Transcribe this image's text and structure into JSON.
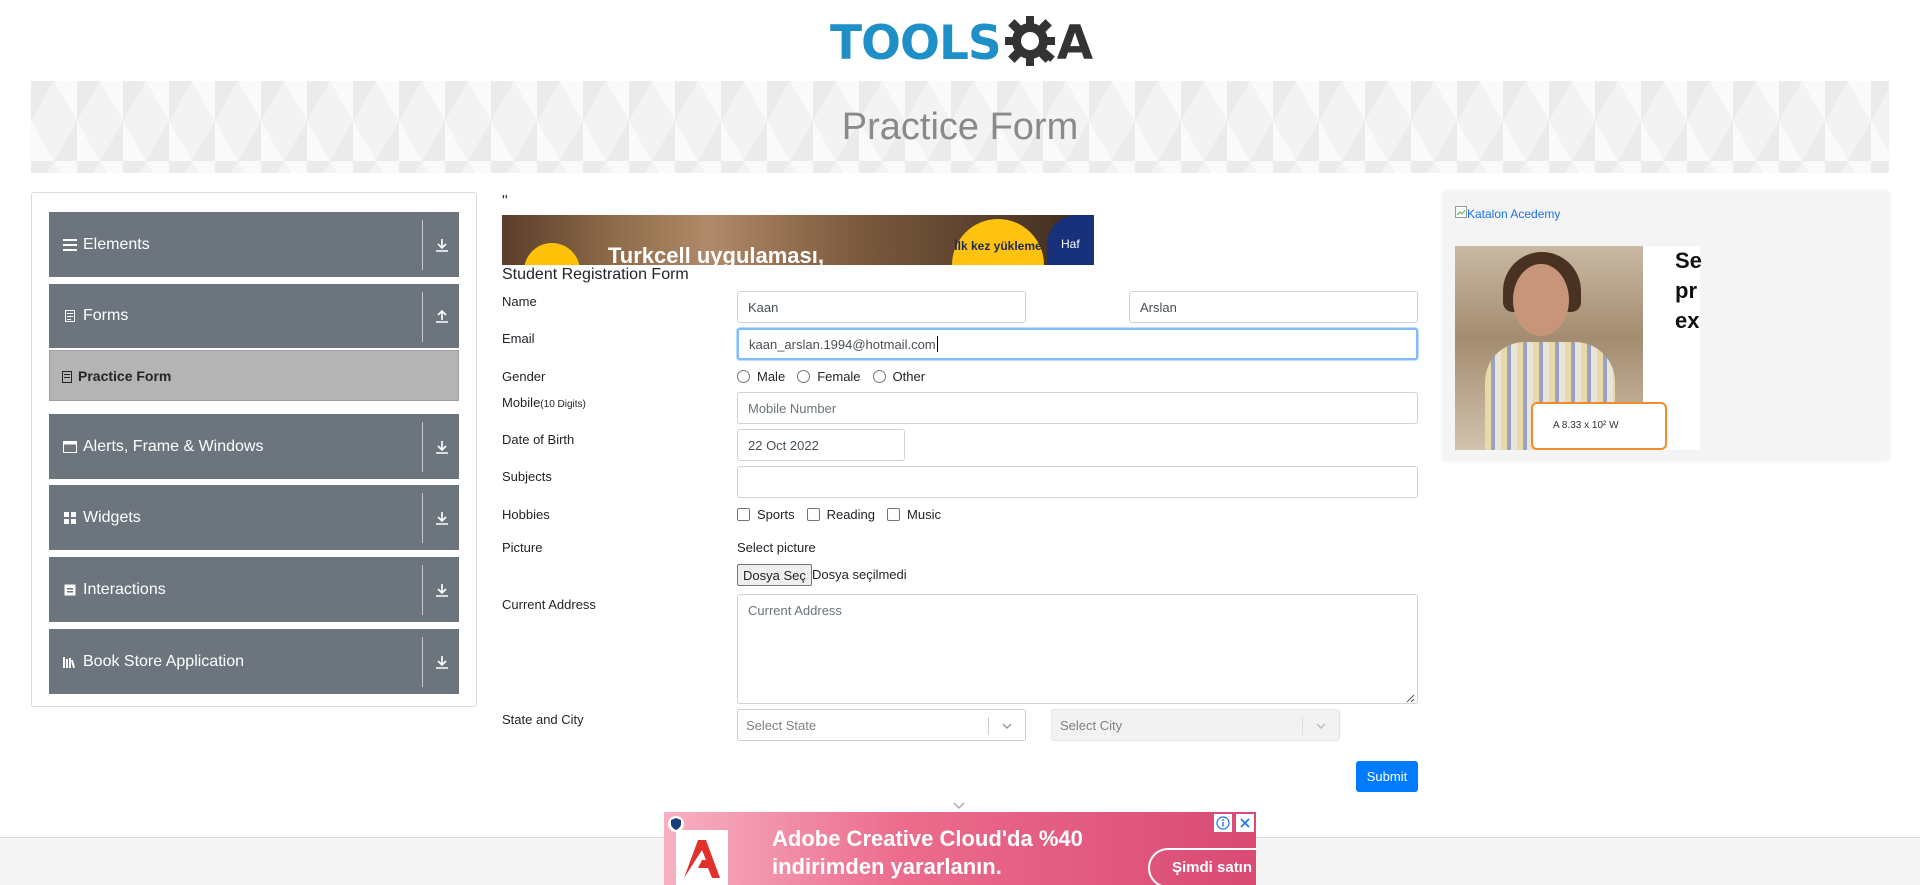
{
  "logo": {
    "text_left": "TOOLS",
    "text_right": "A"
  },
  "banner": {
    "title": "Practice Form"
  },
  "sidebar": {
    "groups": [
      {
        "label": "Elements",
        "icon": "hamburger-icon",
        "arrow": "download-icon"
      },
      {
        "label": "Forms",
        "icon": "form-doc-icon",
        "arrow": "upload-icon"
      },
      {
        "label": "Alerts, Frame & Windows",
        "icon": "window-icon",
        "arrow": "download-icon"
      },
      {
        "label": "Widgets",
        "icon": "grid-icon",
        "arrow": "download-icon"
      },
      {
        "label": "Interactions",
        "icon": "interaction-icon",
        "arrow": "download-icon"
      },
      {
        "label": "Book Store Application",
        "icon": "bookshelf-icon",
        "arrow": "download-icon"
      }
    ],
    "sub_item": {
      "label": "Practice Form",
      "icon": "form-small-icon"
    }
  },
  "main": {
    "quote": "\"",
    "top_ad": {
      "text": "Turkcell uygulaması,",
      "badge": "İlk kez yükleme",
      "side": "Haf"
    },
    "form_title": "Student Registration Form",
    "labels": {
      "name": "Name",
      "email": "Email",
      "gender": "Gender",
      "mobile": "Mobile",
      "mobile_hint": "(10 Digits)",
      "dob": "Date of Birth",
      "subjects": "Subjects",
      "hobbies": "Hobbies",
      "picture": "Picture",
      "address": "Current Address",
      "state_city": "State and City"
    },
    "first_name": "Kaan",
    "last_name": "Arslan",
    "email_value": "kaan_arslan.1994@hotmail.com",
    "gender_options": [
      "Male",
      "Female",
      "Other"
    ],
    "mobile_placeholder": "Mobile Number",
    "dob_value": "22 Oct 2022",
    "subjects_value": "",
    "hobby_options": [
      "Sports",
      "Reading",
      "Music"
    ],
    "picture_label": "Select picture",
    "file_button": "Dosya Seç",
    "file_status": "Dosya seçilmedi",
    "address_placeholder": "Current Address",
    "state_placeholder": "Select State",
    "city_placeholder": "Select City",
    "submit_label": "Submit"
  },
  "right_ad": {
    "broken_alt": "Katalon Acedemy",
    "headline_lines": [
      "Se",
      "pr",
      "ex"
    ],
    "card_text": "A     8.33 x 10² W"
  },
  "bottom_ad": {
    "line1": "Adobe Creative Cloud'da %40",
    "line2": "indirimden yararlanın.",
    "cta": "Şimdi satın"
  },
  "colors": {
    "primary": "#007bff",
    "sidebar": "#6c757d",
    "logo_blue": "#1e90c7"
  }
}
